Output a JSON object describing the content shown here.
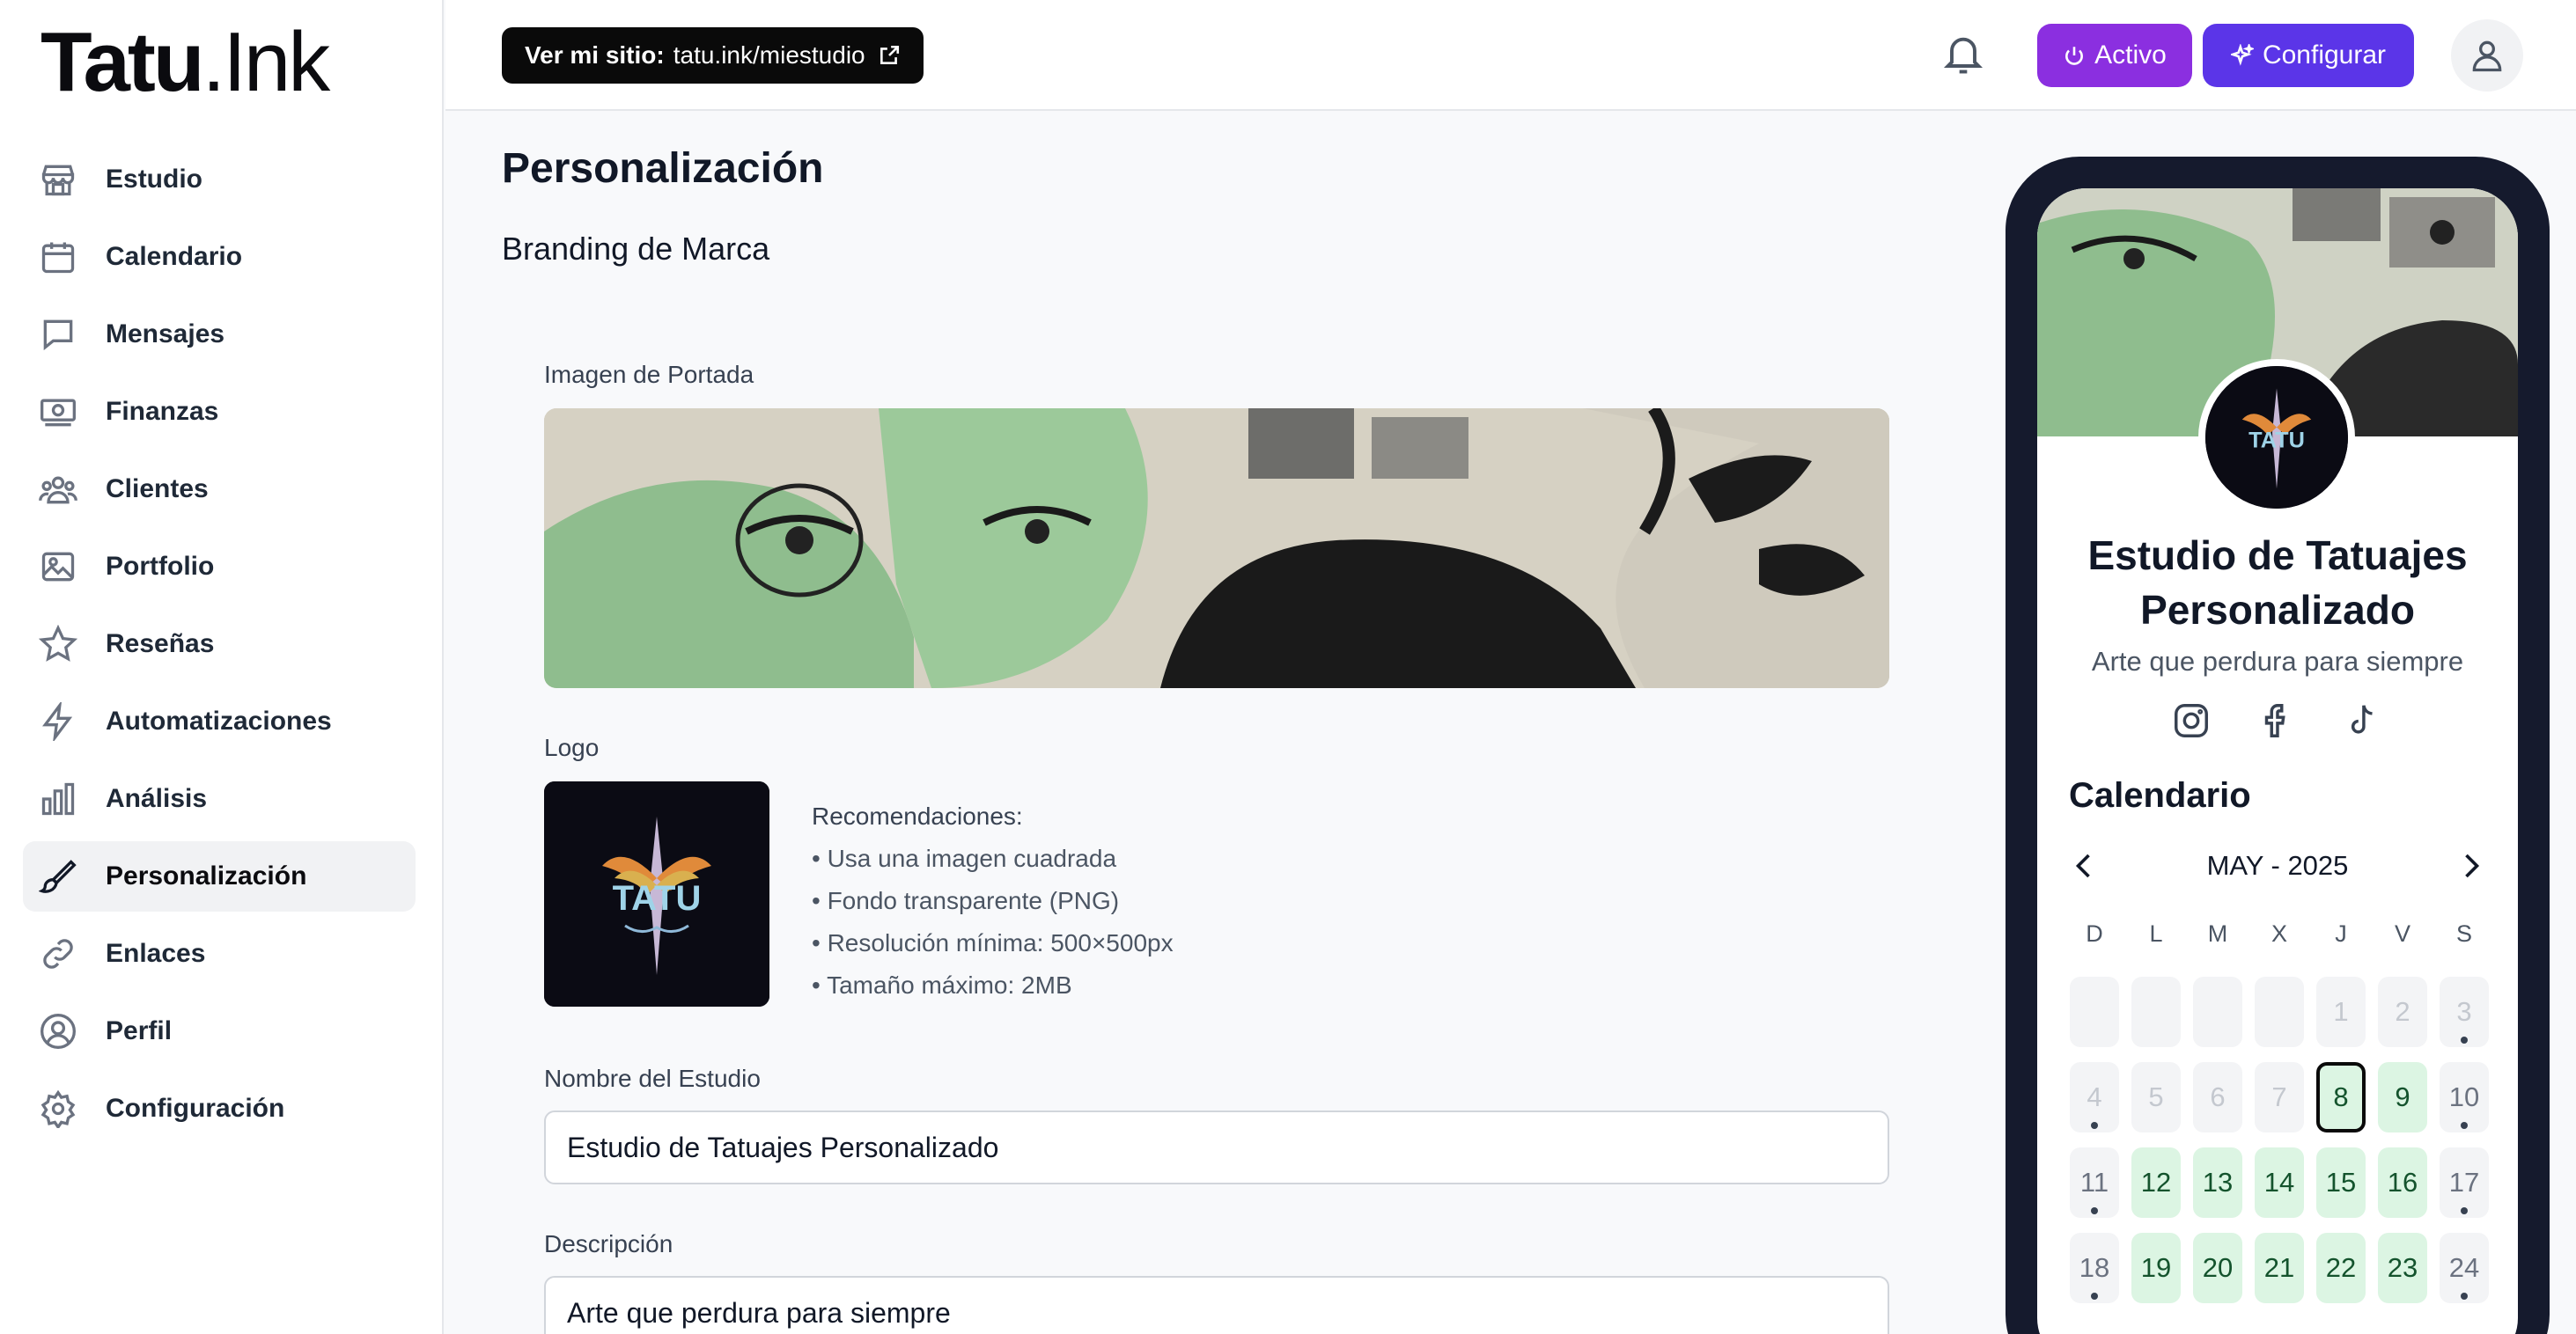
{
  "brand": {
    "logo_bold": "Tatu",
    "logo_light": ".Ink"
  },
  "sidebar": {
    "items": [
      {
        "label": "Estudio",
        "icon": "store-icon"
      },
      {
        "label": "Calendario",
        "icon": "calendar-icon"
      },
      {
        "label": "Mensajes",
        "icon": "message-icon"
      },
      {
        "label": "Finanzas",
        "icon": "banknote-icon"
      },
      {
        "label": "Clientes",
        "icon": "users-icon"
      },
      {
        "label": "Portfolio",
        "icon": "image-icon"
      },
      {
        "label": "Reseñas",
        "icon": "star-icon"
      },
      {
        "label": "Automatizaciones",
        "icon": "zap-icon"
      },
      {
        "label": "Análisis",
        "icon": "bar-chart-icon"
      },
      {
        "label": "Personalización",
        "icon": "paintbrush-icon",
        "active": true
      },
      {
        "label": "Enlaces",
        "icon": "link-icon"
      },
      {
        "label": "Perfil",
        "icon": "user-circle-icon"
      },
      {
        "label": "Configuración",
        "icon": "gear-icon"
      }
    ]
  },
  "header": {
    "site_label": "Ver mi sitio:",
    "site_url": "tatu.ink/miestudio",
    "activo_label": "Activo",
    "config_label": "Configurar",
    "accent_purple": "#8b2fe0",
    "accent_indigo": "#5b35e8"
  },
  "main": {
    "title": "Personalización",
    "section": "Branding de Marca",
    "cover_label": "Imagen de Portada",
    "logo_label": "Logo",
    "logo_text": "TATU",
    "recommendations_title": "Recomendaciones:",
    "recommendations": [
      "• Usa una imagen cuadrada",
      "• Fondo transparente (PNG)",
      "• Resolución mínima: 500×500px",
      "• Tamaño máximo: 2MB"
    ],
    "studio_name_label": "Nombre del Estudio",
    "studio_name_value": "Estudio de Tatuajes Personalizado",
    "description_label": "Descripción",
    "description_value": "Arte que perdura para siempre"
  },
  "preview": {
    "studio_name": "Estudio de Tatuajes Personalizado",
    "tagline": "Arte que perdura para siempre",
    "socials": [
      "instagram-icon",
      "facebook-icon",
      "tiktok-icon"
    ],
    "calendar_title": "Calendario",
    "month": "MAY - 2025",
    "weekdays": [
      "D",
      "L",
      "M",
      "X",
      "J",
      "V",
      "S"
    ],
    "days": [
      {
        "n": "",
        "s": "empty"
      },
      {
        "n": "",
        "s": "empty"
      },
      {
        "n": "",
        "s": "empty"
      },
      {
        "n": "",
        "s": "empty"
      },
      {
        "n": "1",
        "s": "past"
      },
      {
        "n": "2",
        "s": "past"
      },
      {
        "n": "3",
        "s": "past",
        "dot": true
      },
      {
        "n": "4",
        "s": "past",
        "dot": true
      },
      {
        "n": "5",
        "s": "past"
      },
      {
        "n": "6",
        "s": "past"
      },
      {
        "n": "7",
        "s": "past"
      },
      {
        "n": "8",
        "s": "today"
      },
      {
        "n": "9",
        "s": "avail"
      },
      {
        "n": "10",
        "s": "closed",
        "dot": true
      },
      {
        "n": "11",
        "s": "closed",
        "dot": true
      },
      {
        "n": "12",
        "s": "avail"
      },
      {
        "n": "13",
        "s": "avail"
      },
      {
        "n": "14",
        "s": "avail"
      },
      {
        "n": "15",
        "s": "avail"
      },
      {
        "n": "16",
        "s": "avail"
      },
      {
        "n": "17",
        "s": "closed",
        "dot": true
      },
      {
        "n": "18",
        "s": "closed",
        "dot": true
      },
      {
        "n": "19",
        "s": "avail"
      },
      {
        "n": "20",
        "s": "avail"
      },
      {
        "n": "21",
        "s": "avail"
      },
      {
        "n": "22",
        "s": "avail"
      },
      {
        "n": "23",
        "s": "avail"
      },
      {
        "n": "24",
        "s": "closed",
        "dot": true
      }
    ]
  }
}
